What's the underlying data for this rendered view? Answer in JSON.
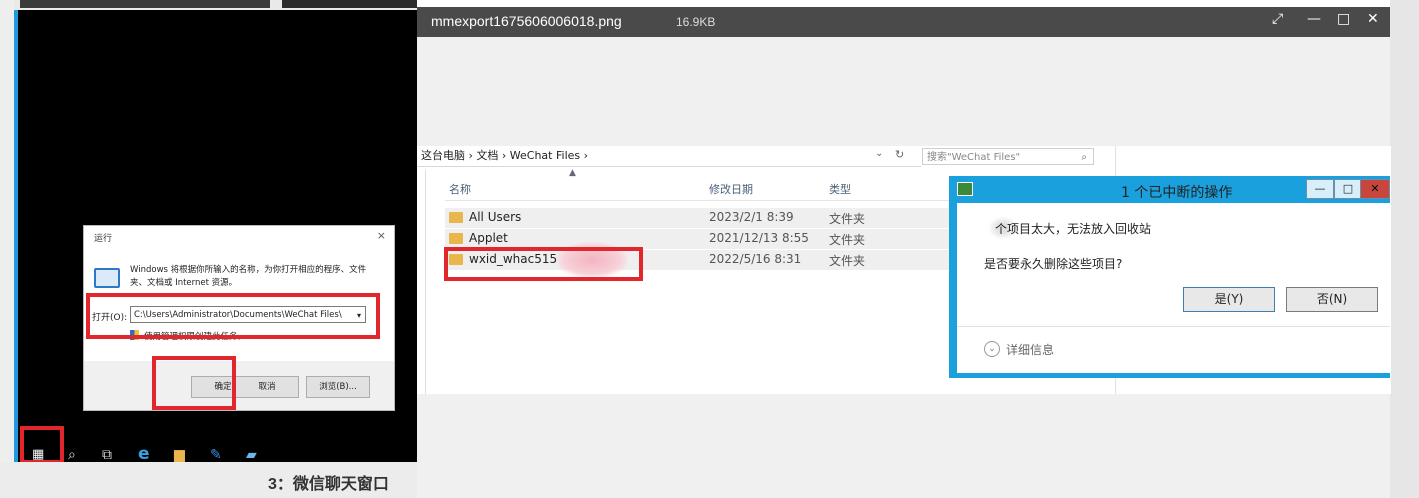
{
  "viewer": {
    "filename": "mmexport1675606006018.png",
    "size": "16.9KB",
    "ctl_expand": "⤢",
    "ctl_min": "—",
    "ctl_max": "□",
    "ctl_close": "✕"
  },
  "run_dialog": {
    "title": "运行",
    "close": "×",
    "description": "Windows 将根据你所输入的名称，为你打开相应的程序、文件夹、文档或 Internet 资源。",
    "open_label": "打开(O):",
    "input_value": "C:\\Users\\Administrator\\Documents\\WeChat Files\\",
    "admin_text": "使用管理权限创建此任务。",
    "ok": "确定",
    "cancel": "取消",
    "browse": "浏览(B)..."
  },
  "explorer": {
    "breadcrumb": "这台电脑  ›  文档  ›  WeChat Files  ›",
    "search_placeholder": "搜索\"WeChat Files\"",
    "columns": {
      "name": "名称",
      "date": "修改日期",
      "type": "类型"
    },
    "rows": [
      {
        "name": "All Users",
        "date": "2023/2/1 8:39",
        "type": "文件夹"
      },
      {
        "name": "Applet",
        "date": "2021/12/13 8:55",
        "type": "文件夹"
      },
      {
        "name": "wxid_whac515",
        "date": "2022/5/16 8:31",
        "type": "文件夹"
      }
    ]
  },
  "interrupted_dialog": {
    "title": "1 个已中断的操作",
    "message1": "个项目太大，无法放入回收站",
    "message2": "是否要永久删除这些项目?",
    "yes": "是(Y)",
    "no": "否(N)",
    "details": "详细信息",
    "ctl_min": "—",
    "ctl_max": "□",
    "ctl_close": "✕"
  },
  "taskbar": {
    "start_icon": "windows-logo",
    "search_icon": "search",
    "taskview_icon": "task-view",
    "edge_icon": "ie",
    "explorer_icon": "folder"
  },
  "caption": {
    "text": "3：微信聊天窗口"
  },
  "colors": {
    "highlight": "#e1262c",
    "dialog_frame": "#1aa0dd",
    "viewer_title": "#4a4a4a"
  }
}
